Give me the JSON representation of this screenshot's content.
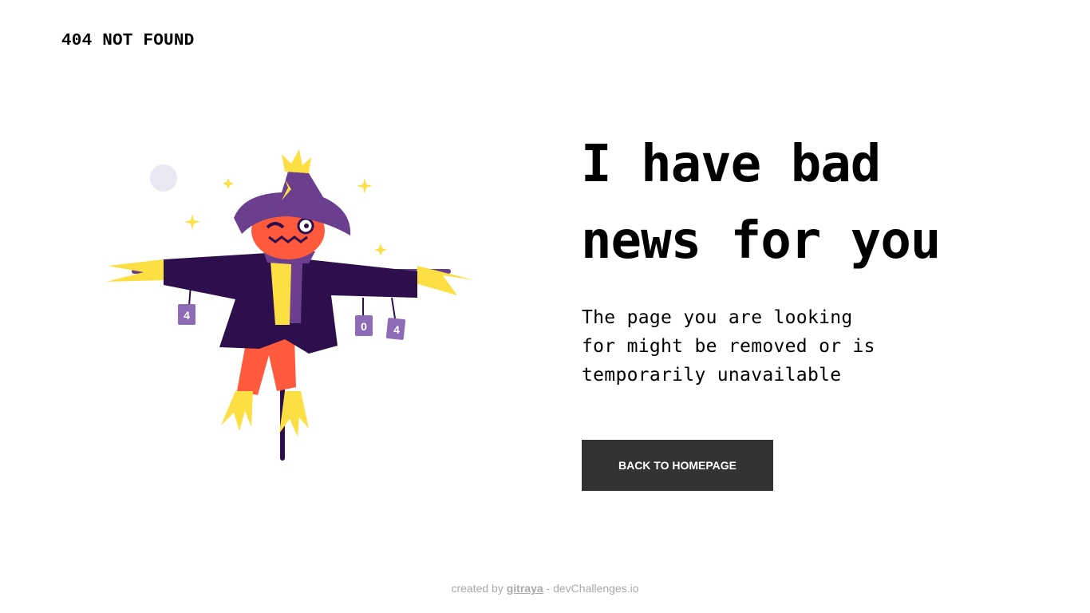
{
  "header": {
    "brand": "404 NOT FOUND"
  },
  "main": {
    "headline_line1": "I have bad",
    "headline_line2": "news for you",
    "description_line1": "The page you are looking",
    "description_line2": "for might be removed or is",
    "description_line3": "temporarily unavailable",
    "button_label": "BACK TO HOMEPAGE"
  },
  "illustration": {
    "icon": "scarecrow-illustration",
    "can_labels": [
      "4",
      "0",
      "4"
    ]
  },
  "footer": {
    "prefix": "created by ",
    "author": "gitraya",
    "suffix": " - devChallenges.io"
  },
  "colors": {
    "button_bg": "#333333",
    "hat": "#6B3F8E",
    "coat": "#2E0F4D",
    "head": "#FF5A3C",
    "straw": "#FCE043"
  }
}
